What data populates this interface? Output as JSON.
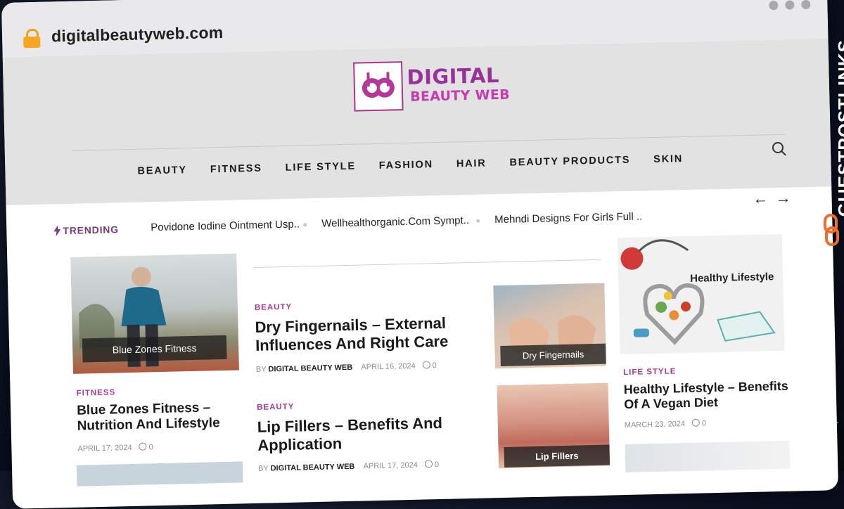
{
  "browser": {
    "url": "digitalbeautyweb.com"
  },
  "logo": {
    "line1": "DIGITAL",
    "line2": "BEAUTY WEB"
  },
  "nav": [
    "BEAUTY",
    "FITNESS",
    "LIFE STYLE",
    "FASHION",
    "HAIR",
    "BEAUTY PRODUCTS",
    "SKIN"
  ],
  "trending": {
    "label": "TRENDING",
    "items": [
      "Povidone Iodine Ointment Usp..",
      "Wellhealthorganic.Com Sympt..",
      "Mehndi Designs For Girls Full  .."
    ]
  },
  "articles": {
    "left": {
      "image_label": "Blue Zones Fitness",
      "category": "FITNESS",
      "title": "Blue Zones Fitness – Nutrition And Lifestyle",
      "date": "APRIL 17, 2024",
      "comments": "0"
    },
    "mid1": {
      "category": "BEAUTY",
      "title": "Dry Fingernails – External Influences And Right Care",
      "by": "BY",
      "author": "DIGITAL BEAUTY WEB",
      "date": "APRIL 16, 2024",
      "comments": "0"
    },
    "mid2": {
      "category": "BEAUTY",
      "title": "Lip Fillers – Benefits And Application",
      "by": "BY",
      "author": "DIGITAL BEAUTY WEB",
      "date": "APRIL 17, 2024",
      "comments": "0"
    },
    "thumb1": {
      "image_label": "Dry Fingernails"
    },
    "thumb2": {
      "image_label": "Lip Fillers"
    },
    "right": {
      "image_text": "Healthy Lifestyle",
      "category": "LIFE STYLE",
      "title": "Healthy Lifestyle – Benefits Of A Vegan Diet",
      "date": "MARCH 23, 2024",
      "comments": "0"
    }
  },
  "watermark": {
    "text": "GUESTPOSTLINKS"
  },
  "colors": {
    "brand": "#9b2f9b",
    "category": "#b4359a",
    "header_bg": "#e2e2e2",
    "lock": "#f6a623",
    "watermark_accent": "#f26b2a"
  }
}
